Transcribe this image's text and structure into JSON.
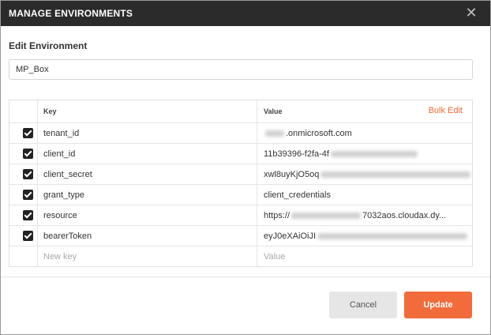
{
  "dialog": {
    "title": "MANAGE ENVIRONMENTS",
    "close_glyph": "✕",
    "section_title": "Edit Environment"
  },
  "environment": {
    "name": "MP_Box"
  },
  "table": {
    "header_key": "Key",
    "header_value": "Value",
    "bulk_edit": "Bulk Edit",
    "rows": [
      {
        "key": "tenant_id",
        "checked": true,
        "value_visible": ".onmicrosoft.com"
      },
      {
        "key": "client_id",
        "checked": true,
        "value_visible": "11b39396-f2fa-4f"
      },
      {
        "key": "client_secret",
        "checked": true,
        "value_visible": "xwl8uyKjO5oq"
      },
      {
        "key": "grant_type",
        "checked": true,
        "value_visible": "client_credentials"
      },
      {
        "key": "resource",
        "checked": true,
        "value_visible_prefix": "https://",
        "value_visible_suffix": "7032aos.cloudax.dy..."
      },
      {
        "key": "bearerToken",
        "checked": true,
        "value_visible": "eyJ0eXAiOiJI"
      }
    ],
    "new_key_placeholder": "New key",
    "new_value_placeholder": "Value"
  },
  "footer": {
    "cancel_label": "Cancel",
    "update_label": "Update"
  },
  "colors": {
    "titlebar": "#2b2b2b",
    "accent": "#f26b3a",
    "cancel_bg": "#e6e6e6"
  },
  "icons": {
    "close": "close-icon",
    "checkbox": "checkmark-icon"
  }
}
